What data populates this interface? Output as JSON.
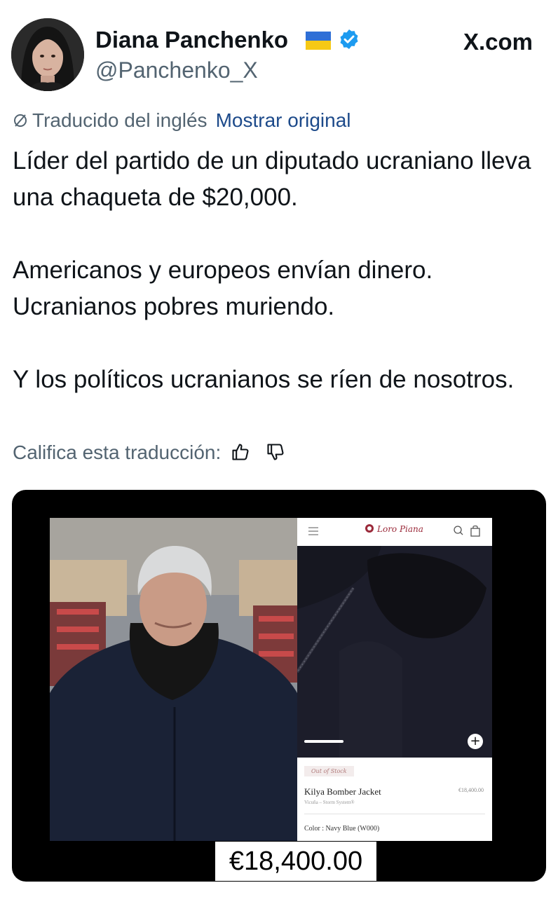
{
  "author": {
    "display_name": "Diana Panchenko",
    "handle": "@Panchenko_X",
    "flag_icon": "ukraine-flag-icon",
    "verified_icon": "verified-badge-icon",
    "verified_color": "#1d9bf0"
  },
  "site_brand": "X.com",
  "translation": {
    "label": "Traducido del inglés",
    "show_original": "Mostrar original",
    "link_color": "#1d4a8a"
  },
  "tweet": {
    "paragraph_1": "Líder del partido de un diputado ucraniano lleva una chaqueta de $20,000.",
    "paragraph_2_line_1": "Americanos y europeos envían dinero.",
    "paragraph_2_line_2": "Ucranianos pobres muriendo.",
    "paragraph_3": "Y los políticos ucranianos se ríen de nosotros."
  },
  "rating": {
    "label": "Califica esta traducción:",
    "thumbs_up_icon": "thumbs-up-icon",
    "thumbs_down_icon": "thumbs-down-icon"
  },
  "media": {
    "shop": {
      "brand": "Loro Piana",
      "stock_status": "Out of Stock",
      "product_name": "Kilya Bomber Jacket",
      "product_price": "€18,400.00",
      "material": "Vicuña – Storm System®",
      "color": "Color : Navy Blue (W000)"
    },
    "price_caption": "€18,400.00"
  }
}
